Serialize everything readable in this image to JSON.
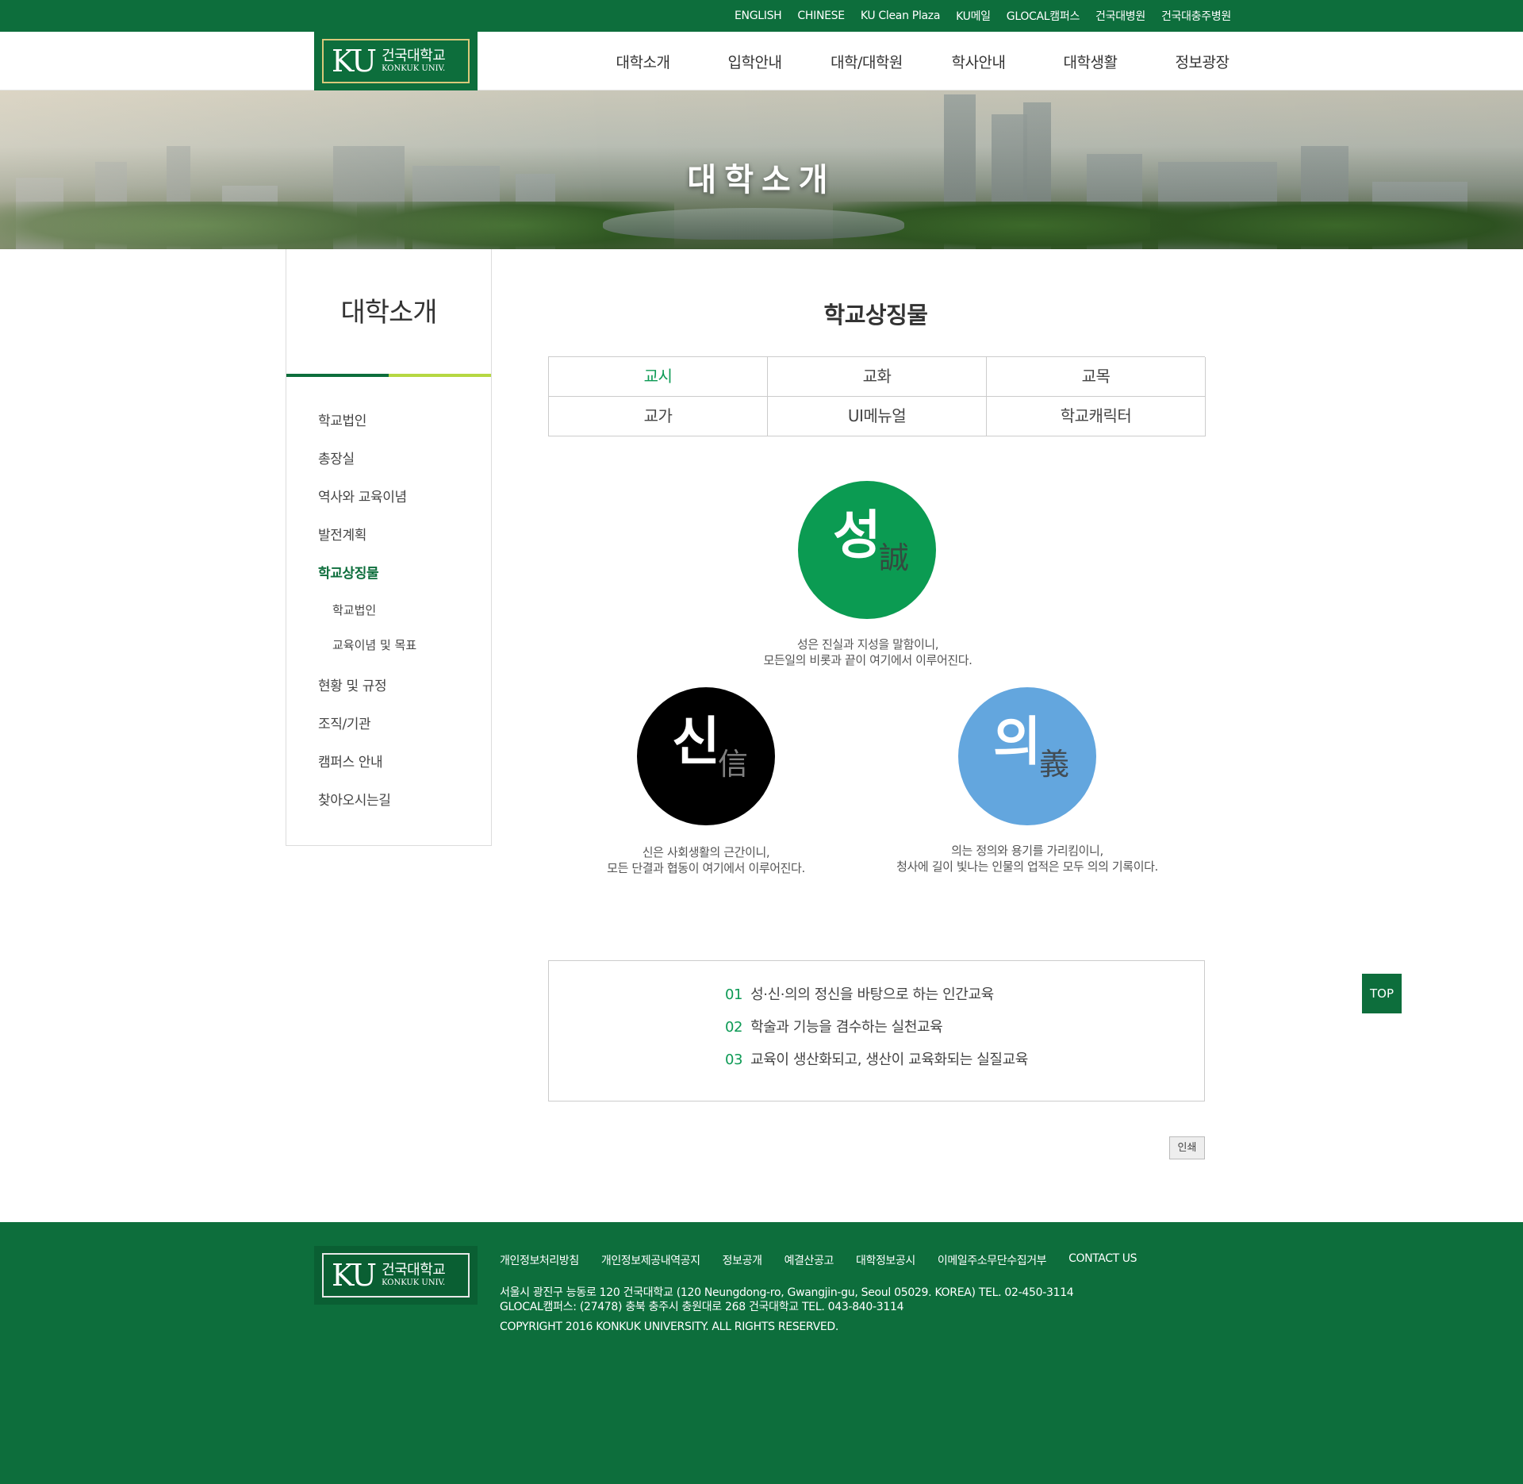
{
  "utility_links": [
    "ENGLISH",
    "CHINESE",
    "KU Clean Plaza",
    "KU메일",
    "GLOCAL캠퍼스",
    "건국대병원",
    "건국대충주병원"
  ],
  "logo": {
    "mark": "KU",
    "korean": "건국대학교",
    "english": "KONKUK UNIV."
  },
  "gnb": [
    "대학소개",
    "입학안내",
    "대학/대학원",
    "학사안내",
    "대학생활",
    "정보광장"
  ],
  "hero": {
    "title": "대학소개"
  },
  "sidebar": {
    "title": "대학소개",
    "items": [
      {
        "label": "학교법인"
      },
      {
        "label": "총장실"
      },
      {
        "label": "역사와 교육이념"
      },
      {
        "label": "발전계획"
      },
      {
        "label": "학교상징물",
        "active": true
      },
      {
        "label": "학교법인",
        "sub": true
      },
      {
        "label": "교육이념 및 목표",
        "sub": true
      },
      {
        "label": "현황 및 규정"
      },
      {
        "label": "조직/기관"
      },
      {
        "label": "캠퍼스 안내"
      },
      {
        "label": "찾아오시는길"
      }
    ]
  },
  "content": {
    "title": "학교상징물",
    "tabs": [
      {
        "label": "교시",
        "active": true
      },
      {
        "label": "교화"
      },
      {
        "label": "교목"
      },
      {
        "label": "교가"
      },
      {
        "label": "UI메뉴얼"
      },
      {
        "label": "학교캐릭터"
      }
    ],
    "virtues": [
      {
        "char": "성",
        "hanja": "誠",
        "color": "#0b9b52",
        "desc1": "성은 진실과 지성을 말함이니,",
        "desc2": "모든일의 비롯과 끝이 여기에서 이루어진다."
      },
      {
        "char": "신",
        "hanja": "信",
        "color": "#000000",
        "desc1": "신은 사회생활의 근간이니,",
        "desc2": "모든 단결과 협동이 여기에서 이루어진다."
      },
      {
        "char": "의",
        "hanja": "義",
        "color": "#63a6de",
        "desc1": "의는 정의와 용기를 가리킴이니,",
        "desc2": "청사에 길이 빛나는 인물의 업적은 모두 의의 기록이다."
      }
    ],
    "goals": [
      {
        "num": "01",
        "text": "성·신·의의 정신을 바탕으로 하는 인간교육"
      },
      {
        "num": "02",
        "text": "학술과 기능을 겸수하는 실천교육"
      },
      {
        "num": "03",
        "text": "교육이 생산화되고, 생산이 교육화되는 실질교육"
      }
    ],
    "print_label": "인쇄"
  },
  "top_button": "TOP",
  "footer": {
    "links": [
      "개인정보처리방침",
      "개인정보제공내역공지",
      "정보공개",
      "예결산공고",
      "대학정보공시",
      "이메일주소무단수집거부",
      "CONTACT US"
    ],
    "address1": "서울시 광진구 능동로 120 건국대학교 (120 Neungdong-ro, Gwangjin-gu, Seoul 05029. KOREA) TEL. 02-450-3114",
    "address2": "GLOCAL캠퍼스: (27478) 충북 충주시 충원대로 268 건국대학교 TEL. 043-840-3114",
    "copyright": "COPYRIGHT 2016 KONKUK UNIVERSITY. ALL RIGHTS RESERVED."
  },
  "colors": {
    "brand": "#0d6e3c",
    "accent": "#0d9a55",
    "lime": "#b6d842"
  }
}
